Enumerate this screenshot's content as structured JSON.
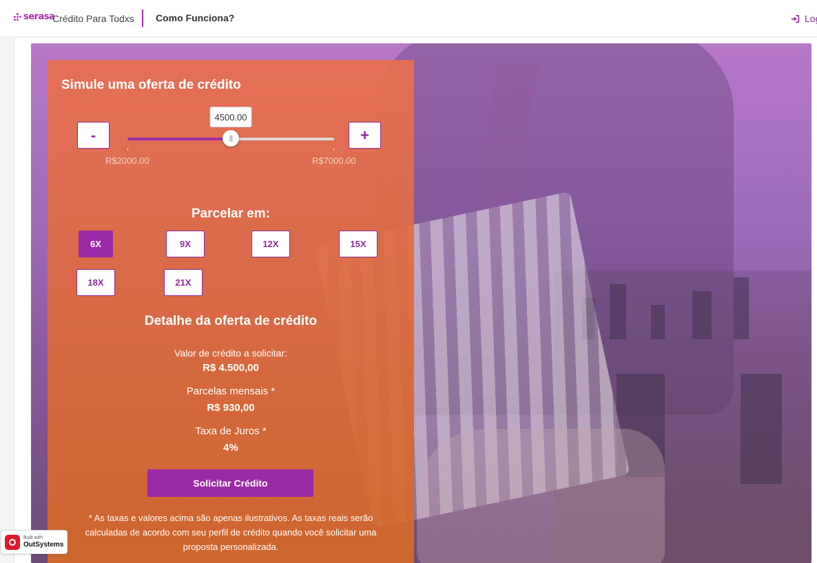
{
  "header": {
    "logo_text": "serasa",
    "app_name": "Crédito Para Todxs",
    "nav_link": "Como Funciona?",
    "login_label": "Login"
  },
  "simulator": {
    "title": "Simule uma oferta de crédito",
    "minus_label": "-",
    "plus_label": "+",
    "slider": {
      "value": 4500,
      "value_text": "4500.00",
      "min": 2000,
      "max": 7000,
      "min_label": "R$2000.00",
      "max_label": "R$7000.00",
      "thumb_grip": "|||"
    }
  },
  "installments": {
    "title": "Parcelar em:",
    "options": [
      "6X",
      "9X",
      "12X",
      "15X",
      "18X",
      "21X"
    ],
    "selected": "6X"
  },
  "details": {
    "title": "Detalhe da oferta de crédito",
    "credit_label": "Valor de crédito a solicitar:",
    "credit_value": "R$ 4.500,00",
    "monthly_label": "Parcelas mensais *",
    "monthly_value": "R$ 930,00",
    "interest_label": "Taxa de Juros *",
    "interest_value": "4%"
  },
  "cta": {
    "solicit_label": "Solicitar Crédito"
  },
  "disclaimer": "* As taxas e valores acima são apenas ilustrativos. As taxas reais serão calculadas de acordo com seu perfil de crédito quando você solicitar uma proposta personalizada.",
  "badge": {
    "built_with": "Built with",
    "platform": "OutSystems"
  },
  "colors": {
    "brand_purple": "#9b2aa6",
    "panel_orange": "#e06b42",
    "accent_text": "#8c2a97"
  },
  "icons": {
    "login": "sign-in-icon",
    "logo": "serasa-dots-logo",
    "badge": "outsystems-logo"
  }
}
